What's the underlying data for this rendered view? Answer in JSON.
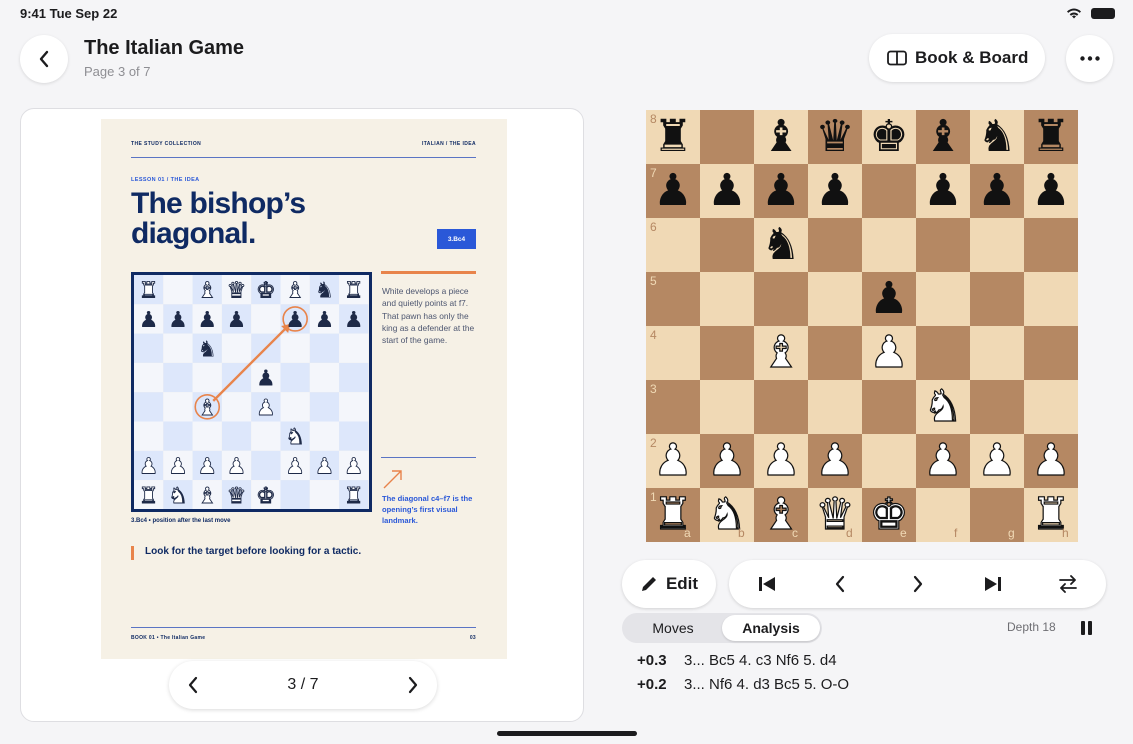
{
  "status_bar": {
    "time": "9:41 Tue Sep 22"
  },
  "header": {
    "title": "The Italian Game",
    "subtitle": "Page 3 of 7",
    "mode_label": "Book & Board"
  },
  "book": {
    "page": {
      "header_left": "THE STUDY COLLECTION",
      "header_right": "ITALIAN / THE IDEA",
      "lesson": "LESSON 01 / THE IDEA",
      "title": "The bishop’s diagonal.",
      "move_badge": "3.Bc4",
      "side_text": "White develops a piece and quietly points at f7. That pawn has only the king as a defender at the start of the game.",
      "side_caption": "The diagonal c4–f7 is the opening’s first visual landmark.",
      "figure_caption": "3.Bc4 • position after the last move",
      "tip": "Look for the target before looking for a tactic.",
      "footer_left": "BOOK 01 • The Italian Game",
      "footer_right": "03"
    },
    "pager": {
      "indicator": "3 / 7"
    }
  },
  "board": {
    "ranks": [
      "8",
      "7",
      "6",
      "5",
      "4",
      "3",
      "2",
      "1"
    ],
    "files": [
      "a",
      "b",
      "c",
      "d",
      "e",
      "f",
      "g",
      "h"
    ],
    "position": [
      [
        "bR",
        "",
        "bB",
        "bQ",
        "bK",
        "bB",
        "bN",
        "bR"
      ],
      [
        "bP",
        "bP",
        "bP",
        "bP",
        "",
        "bP",
        "bP",
        "bP"
      ],
      [
        "",
        "",
        "bN",
        "",
        "",
        "",
        "",
        ""
      ],
      [
        "",
        "",
        "",
        "",
        "bP",
        "",
        "",
        ""
      ],
      [
        "",
        "",
        "wB",
        "",
        "wP",
        "",
        "",
        ""
      ],
      [
        "",
        "",
        "",
        "",
        "",
        "wN",
        "",
        ""
      ],
      [
        "wP",
        "wP",
        "wP",
        "wP",
        "",
        "wP",
        "wP",
        "wP"
      ],
      [
        "wR",
        "wN",
        "wB",
        "wQ",
        "wK",
        "",
        "",
        "wR"
      ]
    ],
    "mini_position": [
      [
        "wR",
        "",
        "wB",
        "wQ",
        "wK",
        "wB",
        "bN",
        "wR"
      ],
      [
        "bP",
        "bP",
        "bP",
        "bP",
        "",
        "bP",
        "bP",
        "bP"
      ],
      [
        "",
        "",
        "bN",
        "",
        "",
        "",
        "",
        ""
      ],
      [
        "",
        "",
        "",
        "",
        "bP",
        "",
        "",
        ""
      ],
      [
        "",
        "",
        "wB",
        "",
        "wP",
        "",
        "",
        ""
      ],
      [
        "",
        "",
        "",
        "",
        "",
        "wN",
        "",
        ""
      ],
      [
        "wP",
        "wP",
        "wP",
        "wP",
        "",
        "wP",
        "wP",
        "wP"
      ],
      [
        "wR",
        "wN",
        "wB",
        "wQ",
        "wK",
        "",
        "",
        "wR"
      ]
    ],
    "colors": {
      "light": "#f0d9b5",
      "dark": "#b58863"
    }
  },
  "controls": {
    "edit_label": "Edit",
    "tabs": [
      {
        "label": "Moves",
        "active": false
      },
      {
        "label": "Analysis",
        "active": true
      }
    ],
    "depth": "Depth 18"
  },
  "analysis_lines": [
    {
      "score": "+0.3",
      "moves": "3... Bc5 4. c3 Nf6 5. d4"
    },
    {
      "score": "+0.2",
      "moves": "3... Nf6 4. d3 Bc5 5. O-O"
    }
  ],
  "icons": {
    "back": "chevron-left-icon",
    "book_mode": "book-columns-icon",
    "more": "ellipsis-icon",
    "edit": "pencil-icon",
    "first": "skip-to-start-icon",
    "prev": "chevron-left-icon",
    "next": "chevron-right-icon",
    "last": "skip-to-end-icon",
    "flip": "flip-board-icon",
    "pause": "pause-icon"
  }
}
